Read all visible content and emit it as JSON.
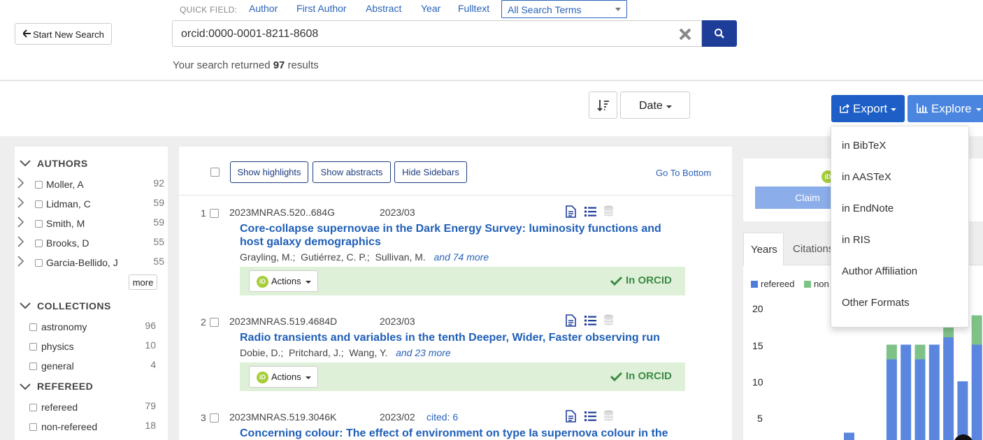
{
  "search": {
    "quick_field_label": "QUICK FIELD:",
    "quick_fields": [
      "Author",
      "First Author",
      "Abstract",
      "Year",
      "Fulltext"
    ],
    "terms_select": "All Search Terms",
    "query": "orcid:0000-0001-8211-8608",
    "start_new": "Start New Search",
    "results_prefix": "Your search returned ",
    "results_count": "97",
    "results_suffix": " results"
  },
  "toolbar": {
    "sort_label": "Date",
    "export_label": "Export",
    "explore_label": "Explore"
  },
  "export_menu": [
    "in BibTeX",
    "in AASTeX",
    "in EndNote",
    "in RIS",
    "Author Affiliation",
    "Other Formats"
  ],
  "facets": {
    "authors_title": "AUTHORS",
    "authors": [
      {
        "name": "Moller, A",
        "count": "92"
      },
      {
        "name": "Lidman, C",
        "count": "59"
      },
      {
        "name": "Smith, M",
        "count": "59"
      },
      {
        "name": "Brooks, D",
        "count": "55"
      },
      {
        "name": "Garcia-Bellido, J",
        "count": "55"
      }
    ],
    "more_label": "more",
    "collections_title": "COLLECTIONS",
    "collections": [
      {
        "name": "astronomy",
        "count": "96"
      },
      {
        "name": "physics",
        "count": "10"
      },
      {
        "name": "general",
        "count": "4"
      }
    ],
    "refereed_title": "REFEREED",
    "refereed": [
      {
        "name": "refereed",
        "count": "79"
      },
      {
        "name": "non-refereed",
        "count": "18"
      }
    ]
  },
  "results": {
    "show_highlights": "Show highlights",
    "show_abstracts": "Show abstracts",
    "hide_sidebars": "Hide Sidebars",
    "go_to_bottom": "Go To Bottom",
    "actions_label": "Actions",
    "in_orcid_label": "In ORCID",
    "items": [
      {
        "index": "1",
        "bibcode": "2023MNRAS.520..684G",
        "date": "2023/03",
        "cited": "",
        "title_line1": "Core-collapse supernovae in the Dark Energy Survey: luminosity functions and",
        "title_line2": "host galaxy demographics",
        "authors": [
          "Grayling, M.;",
          "Gutiérrez, C. P.;",
          "Sullivan, M."
        ],
        "more": "and 74 more"
      },
      {
        "index": "2",
        "bibcode": "2023MNRAS.519.4684D",
        "date": "2023/03",
        "cited": "",
        "title_line1": "Radio transients and variables in the tenth Deeper, Wider, Faster observing run",
        "title_line2": "",
        "authors": [
          "Dobie, D.;",
          "Pritchard, J.;",
          "Wang, Y."
        ],
        "more": "and 23 more"
      },
      {
        "index": "3",
        "bibcode": "2023MNRAS.519.3046K",
        "date": "2023/02",
        "cited": "cited: 6",
        "title_line1": "Concerning colour: The effect of environment on type Ia supernova colour in the",
        "title_line2": "",
        "authors": [],
        "more": ""
      }
    ]
  },
  "right_panel": {
    "claim_label": "Claim",
    "tabs": [
      "Years",
      "Citations"
    ],
    "legend": [
      "refereed",
      "non"
    ],
    "y_ticks": [
      "20",
      "15",
      "10",
      "5"
    ],
    "colors": {
      "refereed": "#5b86e0",
      "non_refereed": "#7fc288"
    }
  },
  "chart_data": {
    "type": "bar",
    "legend": [
      "refereed",
      "non"
    ],
    "y_ticks": [
      5,
      10,
      15,
      20
    ],
    "series": [
      {
        "name": "refereed",
        "values": [
          1,
          0,
          0,
          11,
          13,
          11,
          13,
          14,
          8,
          13,
          4
        ]
      },
      {
        "name": "non",
        "values": [
          0,
          0,
          0,
          2,
          0,
          2,
          0,
          2,
          0,
          4,
          0
        ]
      }
    ]
  }
}
